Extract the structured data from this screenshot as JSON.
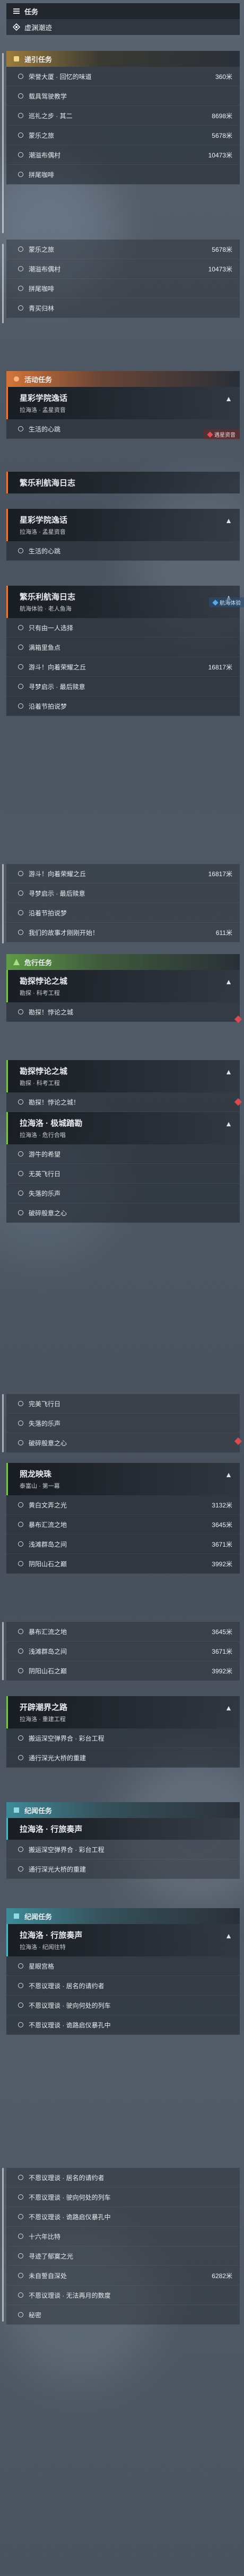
{
  "header": {
    "title": "任务"
  },
  "tracked": {
    "label": "虚渊潮迹"
  },
  "sections": {
    "daily": {
      "title": "递引任务",
      "items": [
        {
          "name": "荣誉大厦 · 回忆的味道",
          "dist": "360米"
        },
        {
          "name": "载具驾驶教学",
          "dist": ""
        },
        {
          "name": "巡礼之步 · 其二",
          "dist": "8698米"
        },
        {
          "name": "蒙乐之旅",
          "dist": "5678米"
        },
        {
          "name": "潮溢布偶村",
          "dist": "10473米"
        },
        {
          "name": "拼尾咖啡",
          "dist": ""
        }
      ],
      "items_b": [
        {
          "name": "蒙乐之旅",
          "dist": "5678米"
        },
        {
          "name": "潮溢布偶村",
          "dist": "10473米"
        },
        {
          "name": "拼尾咖啡",
          "dist": ""
        },
        {
          "name": "青买归林",
          "dist": ""
        }
      ]
    },
    "event": {
      "title": "活动任务",
      "card1": {
        "title": "星彩学院逸话",
        "sub": "拉海洛 · 孟星资音"
      },
      "items1": [
        {
          "name": "生活的心跳",
          "dist": ""
        }
      ],
      "tag1": "遇星资音",
      "card2": {
        "title": "繁乐利航海日志",
        "sub": ""
      },
      "card3": {
        "title": "星彩学院逸话",
        "sub": "拉海洛 · 孟星资音"
      },
      "items2": [
        {
          "name": "生活的心跳",
          "dist": ""
        }
      ],
      "card4": {
        "title": "繁乐利航海日志",
        "sub": "航海体验 · 老人鱼海"
      },
      "tag2": "航海体验",
      "items3": [
        {
          "name": "只有由一人选择",
          "dist": ""
        },
        {
          "name": "满箱里鱼点",
          "dist": ""
        },
        {
          "name": "游斗！向着荣耀之丘",
          "dist": "16817米"
        },
        {
          "name": "寻梦启示 · 最后赎意",
          "dist": ""
        },
        {
          "name": "沿着节拍说梦",
          "dist": ""
        }
      ],
      "items4": [
        {
          "name": "游斗！向着荣耀之丘",
          "dist": "16817米"
        },
        {
          "name": "寻梦启示 · 最后赎意",
          "dist": ""
        },
        {
          "name": "沿着节拍说梦",
          "dist": ""
        },
        {
          "name": "我们的故事才刚刚开始！",
          "dist": "611米"
        }
      ]
    },
    "main": {
      "title": "危行任务",
      "card1": {
        "title": "勘探悖论之城",
        "sub": "勘探 · 科考工程"
      },
      "items1": [
        {
          "name": "勘探！悖论之城",
          "dist": ""
        }
      ],
      "card2": {
        "title": "勘探悖论之城",
        "sub": "勘探 · 科考工程"
      },
      "items2": [
        {
          "name": "勘探！悖论之城！",
          "dist": ""
        }
      ],
      "card3": {
        "title": "拉海洛 · 极城踏勘",
        "sub": "拉海洛 · 危行合唱"
      },
      "items3": [
        {
          "name": "游牛的希望",
          "dist": ""
        },
        {
          "name": "无英飞行日",
          "dist": ""
        },
        {
          "name": "失落的乐声",
          "dist": ""
        },
        {
          "name": "破碎般意之心",
          "dist": ""
        }
      ],
      "items4": [
        {
          "name": "完美飞行日",
          "dist": ""
        },
        {
          "name": "失落的乐声",
          "dist": ""
        },
        {
          "name": "破碎般意之心",
          "dist": ""
        }
      ],
      "card4": {
        "title": "照龙映珠",
        "sub": "泰富山 · 第一幕"
      },
      "items5": [
        {
          "name": "黄白文弄之光",
          "dist": "3132米"
        },
        {
          "name": "暴布汇流之地",
          "dist": "3645米"
        },
        {
          "name": "浅滩群岛之间",
          "dist": "3671米"
        },
        {
          "name": "阴阳山石之巅",
          "dist": "3992米"
        }
      ],
      "items6": [
        {
          "name": "暴布汇流之地",
          "dist": "3645米"
        },
        {
          "name": "浅滩群岛之间",
          "dist": "3671米"
        },
        {
          "name": "阴阳山石之巅",
          "dist": "3992米"
        }
      ],
      "card5": {
        "title": "开辟潮界之路",
        "sub": "拉海洛 · 重建工程"
      },
      "items7": [
        {
          "name": "搬运深空弹界合 · 彩台工程",
          "dist": ""
        },
        {
          "name": "通行深光大桥的重建",
          "dist": ""
        }
      ]
    },
    "story": {
      "title": "纪闻任务",
      "card1": {
        "title": "拉海洛 · 行旅奏声",
        "sub": ""
      },
      "items1": [
        {
          "name": "搬运深空弹界合 · 彩台工程",
          "dist": ""
        },
        {
          "name": "通行深光大桥的重建",
          "dist": ""
        }
      ]
    },
    "story2": {
      "title": "纪闻任务",
      "card1": {
        "title": "拉海洛 · 行旅奏声",
        "sub": "拉海洛 · 纪闻往特"
      },
      "items1": [
        {
          "name": "星眼宫格",
          "dist": ""
        },
        {
          "name": "不恩议理谈 · 居名的请约者",
          "dist": ""
        },
        {
          "name": "不恩议理谈 · 驶向何处的列车",
          "dist": ""
        },
        {
          "name": "不恩议理谈 · 诡路启仪暴孔中",
          "dist": ""
        }
      ],
      "items2": [
        {
          "name": "不恩议理谈 · 居名的请约者",
          "dist": ""
        },
        {
          "name": "不恩议理谈 · 驶向何处的列车",
          "dist": ""
        },
        {
          "name": "不恩议理谈 · 诡路启仪暴孔中",
          "dist": ""
        },
        {
          "name": "十六年比特",
          "dist": ""
        },
        {
          "name": "寻迹了郁寞之光",
          "dist": ""
        },
        {
          "name": "未自誓自深处",
          "dist": "6282米"
        },
        {
          "name": "不恩议理谈 · 无法再月的数度",
          "dist": ""
        },
        {
          "name": "秘密",
          "dist": ""
        }
      ]
    }
  },
  "colors": {
    "gold": "#e7c05a",
    "orange": "#e47a3c",
    "green": "#7fbf55",
    "teal": "#55b4c4",
    "marker": "#d84a55"
  }
}
